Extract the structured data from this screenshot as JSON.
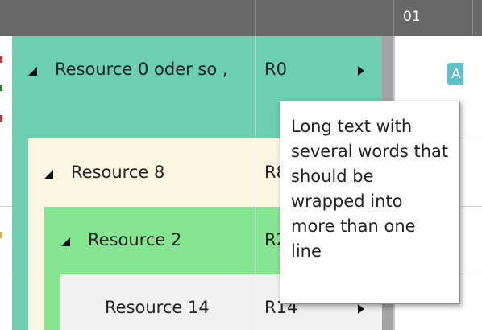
{
  "header": {
    "time_label": "01"
  },
  "rows": [
    {
      "label": "Resource 0 oder so , R0",
      "label_text": "Resource 0 oder so ,",
      "id": "R0",
      "color": "#6bcfb0"
    },
    {
      "label_text": "Resource 8",
      "id": "R8",
      "color": "#fdf6e2"
    },
    {
      "label_text": "Resource 2",
      "id": "R2",
      "color": "#85e591"
    },
    {
      "label_text": "Resource 14",
      "id": "R14",
      "color": "#f1f1f1"
    }
  ],
  "tooltip": {
    "text": "Long text with several words that should be wrapped into more than one line"
  },
  "appointment": {
    "label": "A",
    "color": "#5bc2c7"
  }
}
